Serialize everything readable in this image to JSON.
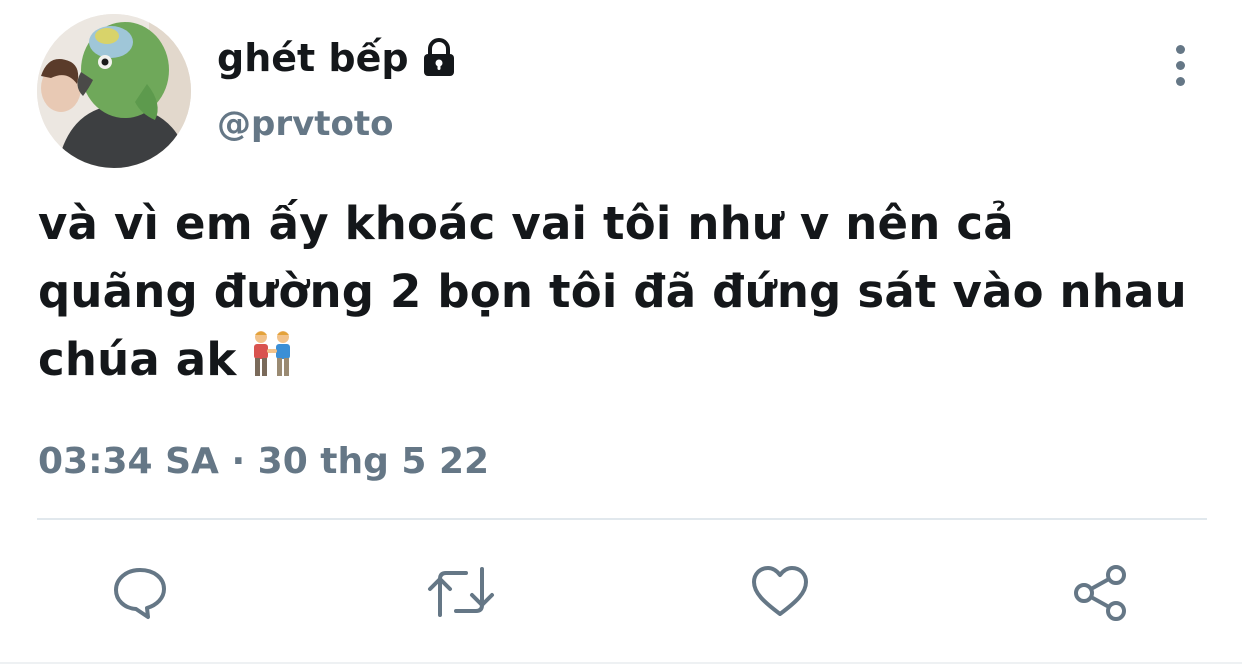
{
  "user": {
    "display_name": "ghét bếp",
    "handle": "@prvtoto",
    "protected_icon": "lock-icon",
    "avatar_icon": "avatar-parrot-photo"
  },
  "tweet": {
    "text": "và vì em ấy khoác vai tôi như v nên cả quãng đường 2 bọn tôi đã đứng sát vào nhau chúa ak",
    "emoji": "couple-holding-hands-emoji",
    "timestamp": "03:34 SA · 30 thg 5 22"
  },
  "actions": {
    "reply_icon": "reply-icon",
    "retweet_icon": "retweet-icon",
    "like_icon": "heart-icon",
    "share_icon": "share-icon",
    "more_icon": "more-vertical-icon"
  },
  "colors": {
    "text_primary": "#14171a",
    "text_secondary": "#657786",
    "divider": "#e1e8ed"
  }
}
